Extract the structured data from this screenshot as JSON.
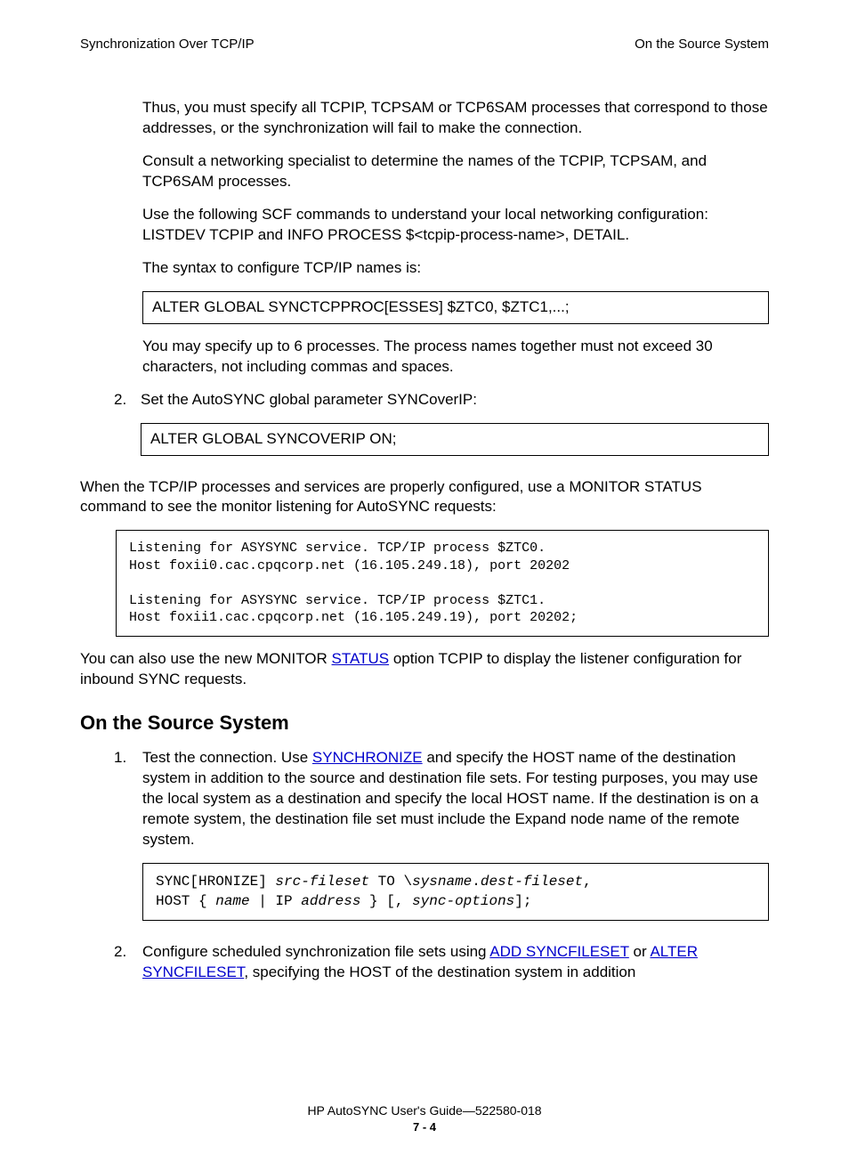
{
  "header": {
    "left": "Synchronization Over TCP/IP",
    "right": "On the Source System"
  },
  "body": {
    "p1": "Thus, you must specify all TCPIP, TCPSAM or TCP6SAM processes that correspond to those addresses, or the synchronization will fail to make the connection.",
    "p2": "Consult a networking specialist to determine the names of the TCPIP, TCPSAM, and TCP6SAM processes.",
    "p3": "Use the following SCF commands to understand your local networking configuration: LISTDEV TCPIP and INFO PROCESS $<tcpip-process-name>, DETAIL.",
    "p4": "The syntax to configure TCP/IP names is:",
    "box1": "ALTER GLOBAL SYNCTCPPROC[ESSES] $ZTC0, $ZTC1,...;",
    "p5": "You may specify up to 6 processes. The process names together must not exceed 30 characters, not including commas and spaces.",
    "step2_num": "2.",
    "step2_text": "Set the AutoSYNC global parameter SYNCoverIP:",
    "box2": "ALTER GLOBAL SYNCOVERIP ON;",
    "p6": "When the TCP/IP processes and services are properly configured, use a MONITOR STATUS command to see the monitor listening for AutoSYNC requests:",
    "listen_box": "Listening for ASYSYNC service. TCP/IP process $ZTC0.\nHost foxii0.cac.cpqcorp.net (16.105.249.18), port 20202\n\nListening for ASYSYNC service. TCP/IP process $ZTC1.\nHost foxii1.cac.cpqcorp.net (16.105.249.19), port 20202;",
    "p7a": "You can also use the new MONITOR ",
    "p7_link": "STATUS",
    "p7b": " option TCPIP to display the listener configuration for inbound SYNC requests.",
    "h2": "On the Source System",
    "s1_num": "1.",
    "s1a": "Test the connection. Use ",
    "s1_link": "SYNCHRONIZE",
    "s1b": " and specify the HOST name of the destination system in addition to the source and destination file sets. For testing purposes, you may use the local system as a destination and specify the local HOST name. If the destination is on a remote system, the destination file set must include the Expand node name of the remote system.",
    "sync_box_l1a": "SYNC[HRONIZE] ",
    "sync_box_l1b": "src-fileset",
    "sync_box_l1c": " TO \\",
    "sync_box_l1d": "sysname",
    "sync_box_l1e": ".",
    "sync_box_l1f": "dest-fileset",
    "sync_box_l1g": ",",
    "sync_box_l2a": "HOST { ",
    "sync_box_l2b": "name",
    "sync_box_l2c": " | IP ",
    "sync_box_l2d": "address",
    "sync_box_l2e": " } [, ",
    "sync_box_l2f": "sync-options",
    "sync_box_l2g": "];",
    "s2_num": "2.",
    "s2a": "Configure scheduled synchronization file sets using ",
    "s2_link1": "ADD SYNCFILESET",
    "s2b": " or ",
    "s2_link2": "ALTER SYNCFILESET",
    "s2c": ", specifying the HOST of the destination system in addition"
  },
  "footer": {
    "line1": "HP AutoSYNC User's Guide—522580-018",
    "page": "7 - 4"
  }
}
